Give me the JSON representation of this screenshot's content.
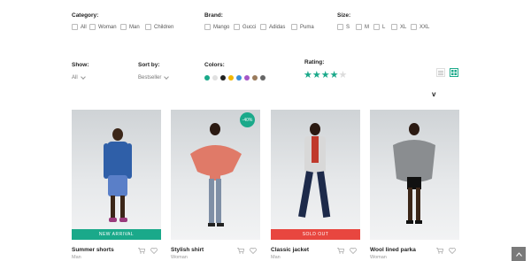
{
  "filters": {
    "category": {
      "label": "Category:",
      "options": [
        "All",
        "Woman",
        "Man",
        "Children"
      ]
    },
    "brand": {
      "label": "Brand:",
      "options": [
        "Mango",
        "Gucci",
        "Adidas",
        "Puma"
      ]
    },
    "size": {
      "label": "Size:",
      "options": [
        "S",
        "M",
        "L",
        "XL",
        "XXL"
      ]
    },
    "show": {
      "label": "Show:",
      "value": "All"
    },
    "sortby": {
      "label": "Sort by:",
      "value": "Bestseller"
    },
    "colors": {
      "label": "Colors:",
      "swatches": [
        "#1aa98a",
        "#e0e0e0",
        "#222222",
        "#f2b600",
        "#3a8fd8",
        "#a557c7",
        "#9a7b5c",
        "#666666"
      ]
    },
    "rating": {
      "label": "Rating:",
      "stars": 4,
      "max": 5,
      "active_color": "#1aa98a"
    }
  },
  "sort_marker": "v",
  "products": [
    {
      "name": "Summer shorts",
      "category": "Man",
      "banner": "NEW ARRIVAL",
      "banner_color": "#1aa98a",
      "badge": ""
    },
    {
      "name": "Stylish shirt",
      "category": "Woman",
      "banner": "",
      "badge": "-40%"
    },
    {
      "name": "Classic jacket",
      "category": "Man",
      "banner": "SOLD OUT",
      "banner_color": "#e8463f",
      "badge": ""
    },
    {
      "name": "Wool lined parka",
      "category": "Woman",
      "banner": "",
      "badge": ""
    }
  ],
  "colors": {
    "accent": "#1aa98a",
    "sold_out": "#e8463f"
  }
}
